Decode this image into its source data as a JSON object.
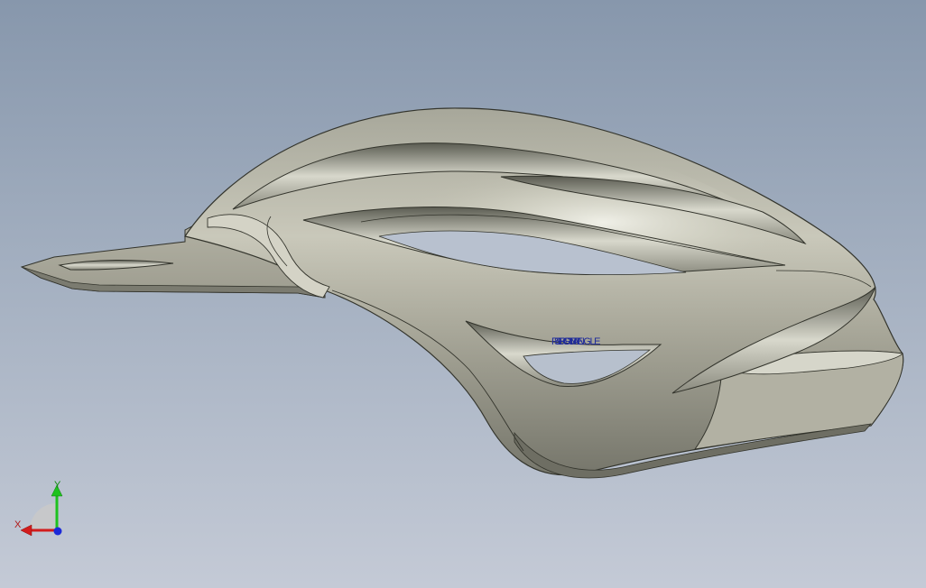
{
  "viewport": {
    "background_top": "#8797ac",
    "background_bottom": "#c4cad6",
    "model": "helmet-model",
    "model_color": "#b6b5a6",
    "edge_color": "#33342c"
  },
  "annotation": {
    "overlapping_texts": [
      "RECTANGLE",
      "FONT",
      "SPRITE"
    ],
    "color": "#1e2a9a"
  },
  "triad": {
    "x_label": "X",
    "y_label": "Y",
    "x_color": "#d21c1c",
    "y_color": "#1ec21e",
    "z_color": "#1b2ad8"
  }
}
